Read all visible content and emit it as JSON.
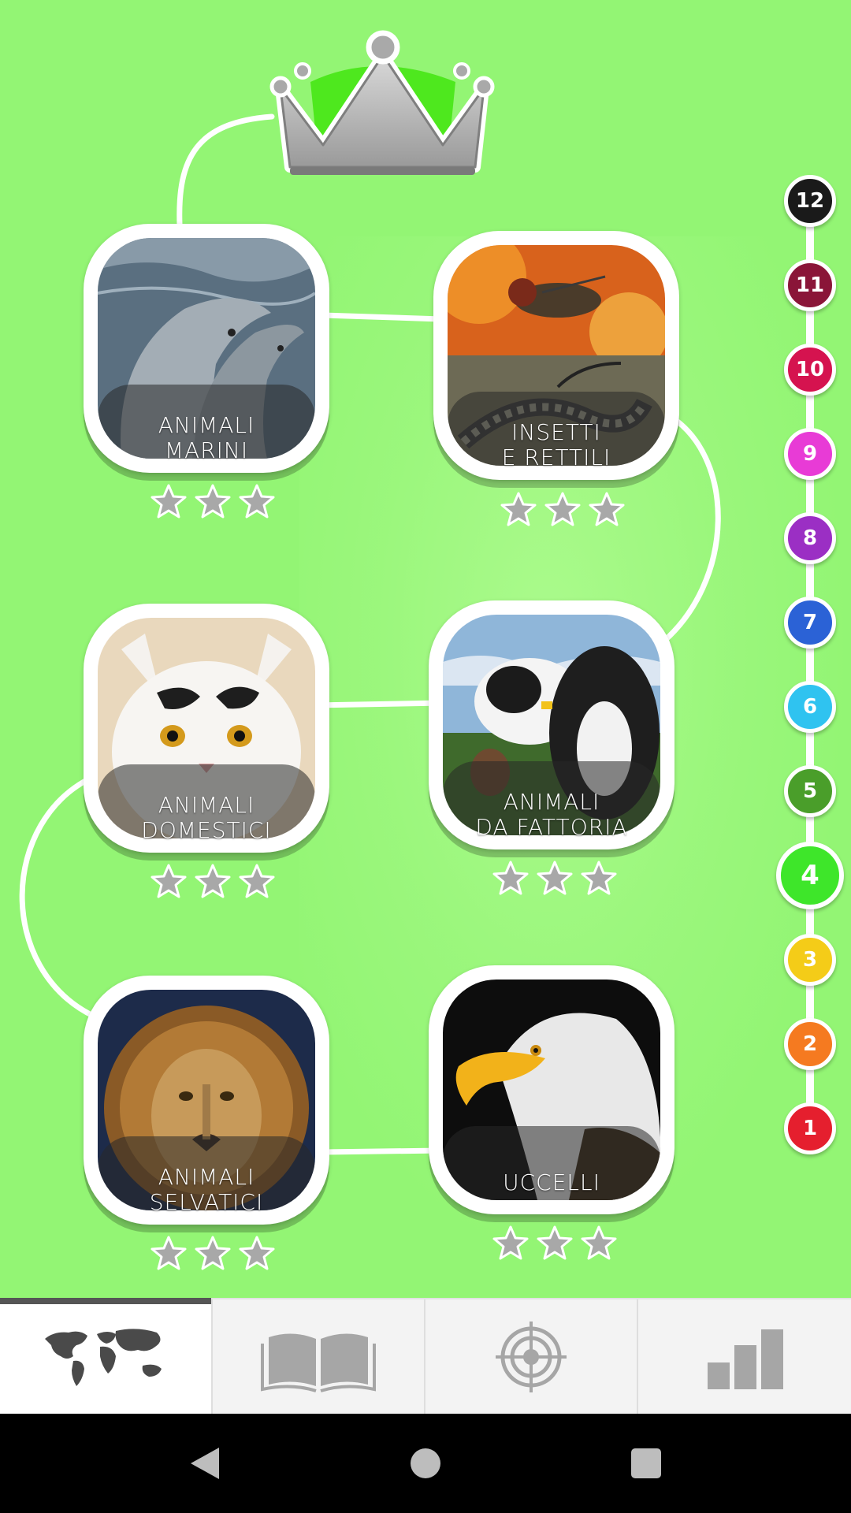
{
  "categories": [
    {
      "id": "marine",
      "label_lines": [
        "ANIMALI",
        "MARINI"
      ],
      "stars_earned": 0,
      "stars_total": 3
    },
    {
      "id": "insects",
      "label_lines": [
        "INSETTI",
        "E RETTILI"
      ],
      "stars_earned": 0,
      "stars_total": 3
    },
    {
      "id": "pets",
      "label_lines": [
        "ANIMALI",
        "DOMESTICI"
      ],
      "stars_earned": 0,
      "stars_total": 3
    },
    {
      "id": "farm",
      "label_lines": [
        "ANIMALI",
        "DA FATTORIA"
      ],
      "stars_earned": 0,
      "stars_total": 3
    },
    {
      "id": "wild",
      "label_lines": [
        "ANIMALI",
        "SELVATICI"
      ],
      "stars_earned": 0,
      "stars_total": 3
    },
    {
      "id": "birds",
      "label_lines": [
        "UCCELLI"
      ],
      "stars_earned": 0,
      "stars_total": 3
    }
  ],
  "levels": [
    {
      "number": "12",
      "color": "#1a1a1a"
    },
    {
      "number": "11",
      "color": "#8a1538"
    },
    {
      "number": "10",
      "color": "#d5134f"
    },
    {
      "number": "9",
      "color": "#e83bd6"
    },
    {
      "number": "8",
      "color": "#9b2fc4"
    },
    {
      "number": "7",
      "color": "#2b62d6"
    },
    {
      "number": "6",
      "color": "#2fc3f0"
    },
    {
      "number": "5",
      "color": "#4a9e2a"
    },
    {
      "number": "4",
      "color": "#3ee62a",
      "active": true
    },
    {
      "number": "3",
      "color": "#f4cc18"
    },
    {
      "number": "2",
      "color": "#f57a20"
    },
    {
      "number": "1",
      "color": "#e51f2e"
    }
  ],
  "tabs": [
    {
      "icon": "world-map-icon",
      "selected": true
    },
    {
      "icon": "book-icon",
      "selected": false
    },
    {
      "icon": "target-icon",
      "selected": false
    },
    {
      "icon": "bar-chart-icon",
      "selected": false
    }
  ],
  "crown": {
    "icon": "crown-icon",
    "progress_fill_color": "#4ee81e"
  },
  "colors": {
    "background": "#93f574",
    "path": "#ffffff",
    "star": "#a8a8a8"
  },
  "system_nav": [
    "back-icon",
    "home-icon",
    "recents-icon"
  ]
}
